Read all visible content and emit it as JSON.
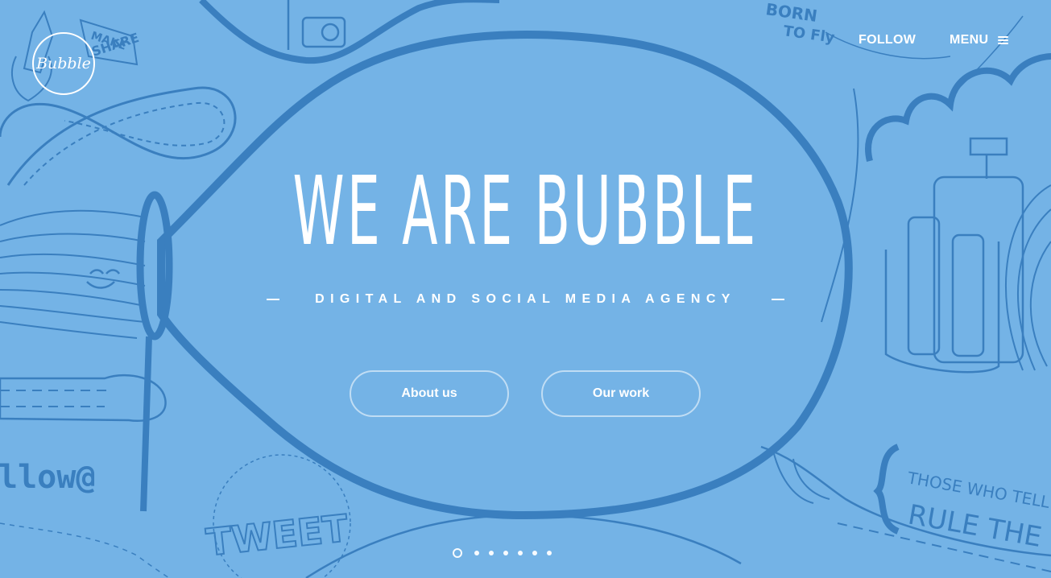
{
  "logo": {
    "text": "Bubble"
  },
  "nav": {
    "follow_label": "FOLLOW",
    "menu_label": "MENU",
    "menu_icon": "hamburger-icon"
  },
  "hero": {
    "title": "WE ARE BUBBLE",
    "tagline": "DIGITAL AND SOCIAL MEDIA AGENCY"
  },
  "buttons": {
    "about_label": "About us",
    "work_label": "Our work"
  },
  "pager": {
    "count": 7,
    "active_index": 0
  },
  "art_text": {
    "born": "BORN",
    "to_fly": "TO Fly",
    "make_share": "MAKE",
    "share": "SHARE",
    "follow_at": "llow@",
    "tweet": "TWEET",
    "quote_line1": "THOSE WHO TELL THE S",
    "quote_line2": "RULE THE WO"
  },
  "colors": {
    "background": "#74b3e6",
    "line_dark": "#3a7fbf",
    "line_mid": "#4b8cc8",
    "text": "#ffffff"
  }
}
